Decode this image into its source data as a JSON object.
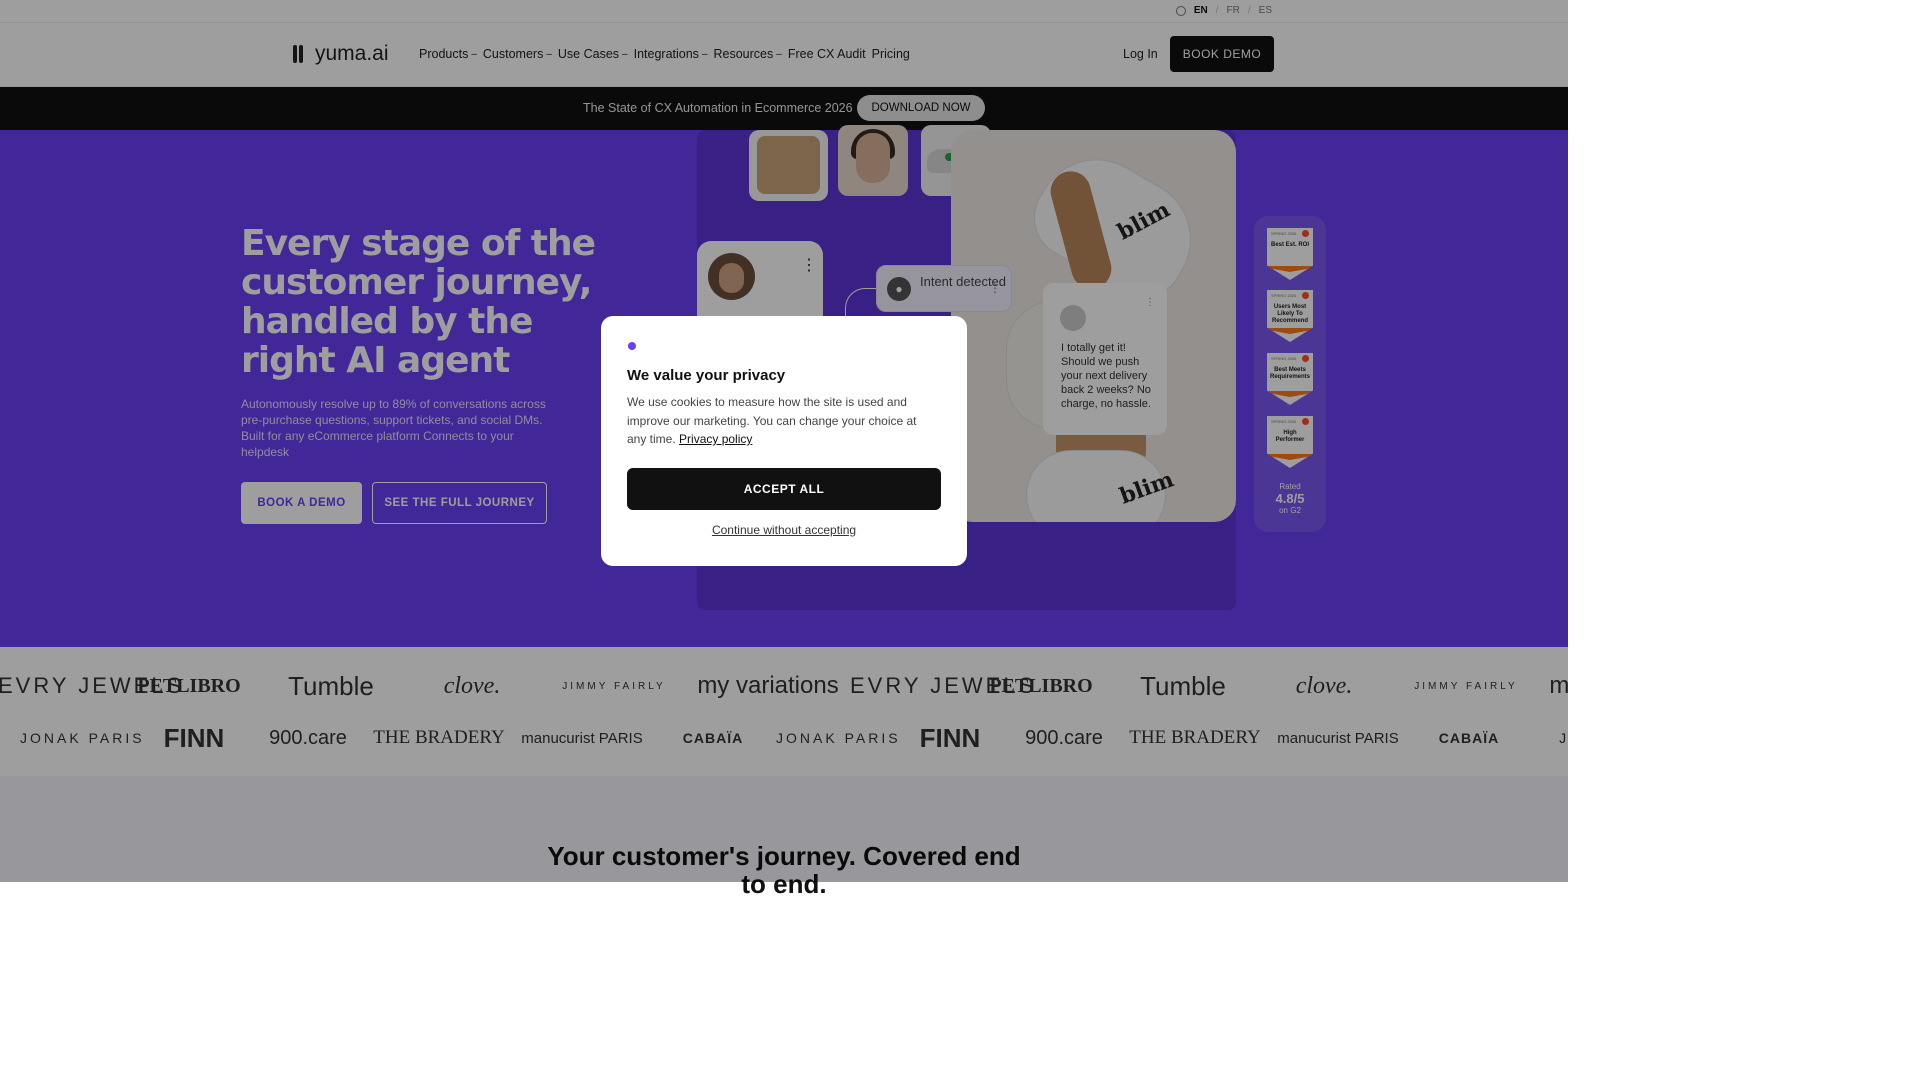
{
  "languages": {
    "items": [
      "EN",
      "FR",
      "ES"
    ],
    "active": "EN",
    "separator": "/"
  },
  "brand": {
    "name": "yuma.ai"
  },
  "nav": {
    "items": [
      "Products",
      "Customers",
      "Use Cases",
      "Integrations",
      "Resources",
      "Free CX Audit",
      "Pricing"
    ],
    "login": "Log In",
    "book": "BOOK DEMO"
  },
  "banner": {
    "text": "The State of CX Automation in Ecommerce 2026",
    "cta": "DOWNLOAD NOW"
  },
  "hero": {
    "title": "Every stage of the customer journey, handled by the right AI agent",
    "subtitle": "Autonomously resolve up to 89% of conversations across pre-purchase questions, support tickets, and social DMs. Built for any eCommerce platform Connects to your helpdesk",
    "cta_primary": "BOOK A DEMO",
    "cta_secondary": "SEE THE FULL JOURNEY"
  },
  "demo": {
    "intent_label": "Intent detected",
    "message": "I totally get it! Should we push your next delivery back 2 weeks? No charge, no hassle.",
    "product_brand": "blim"
  },
  "badges": {
    "items": [
      {
        "season": "SPRING 2026",
        "label": "Best Est. ROI"
      },
      {
        "season": "SPRING 2026",
        "label": "Users Most Likely To Recommend"
      },
      {
        "season": "SPRING 2026",
        "label": "Best Meets Requirements"
      },
      {
        "season": "SPRING 2026",
        "label": "High Performer"
      }
    ],
    "rated_label": "Rated",
    "rating": "4.8/5",
    "rating_source": "on G2"
  },
  "logos": {
    "row1": [
      "EVRY JEWELS",
      "PETLIBRO",
      "Tumble",
      "clove.",
      "JIMMY FAIRLY",
      "my variations",
      "EVRY JEWELS",
      "PETLIBRO",
      "Tumble",
      "clove.",
      "JIMMY FAIRLY",
      "my variations"
    ],
    "row2": [
      "JONAK PARIS",
      "FINN",
      "900.care",
      "THE BRADERY",
      "manucurist PARIS",
      "CABAÏA",
      "JONAK PARIS",
      "FINN",
      "900.care",
      "THE BRADERY",
      "manucurist PARIS",
      "CABAÏA",
      "JONAK"
    ]
  },
  "section2": {
    "title": "Your customer's journey. Covered end to end."
  },
  "cookie": {
    "title": "We value your privacy",
    "body": "We use cookies to measure how the site is used and improve our marketing. You can change your choice at any time.",
    "privacy_link": "Privacy policy",
    "accept": "ACCEPT ALL",
    "decline": "Continue without accepting"
  },
  "colors": {
    "accent": "#6a3ff5",
    "dark": "#111111",
    "g2": "#ff492c"
  }
}
